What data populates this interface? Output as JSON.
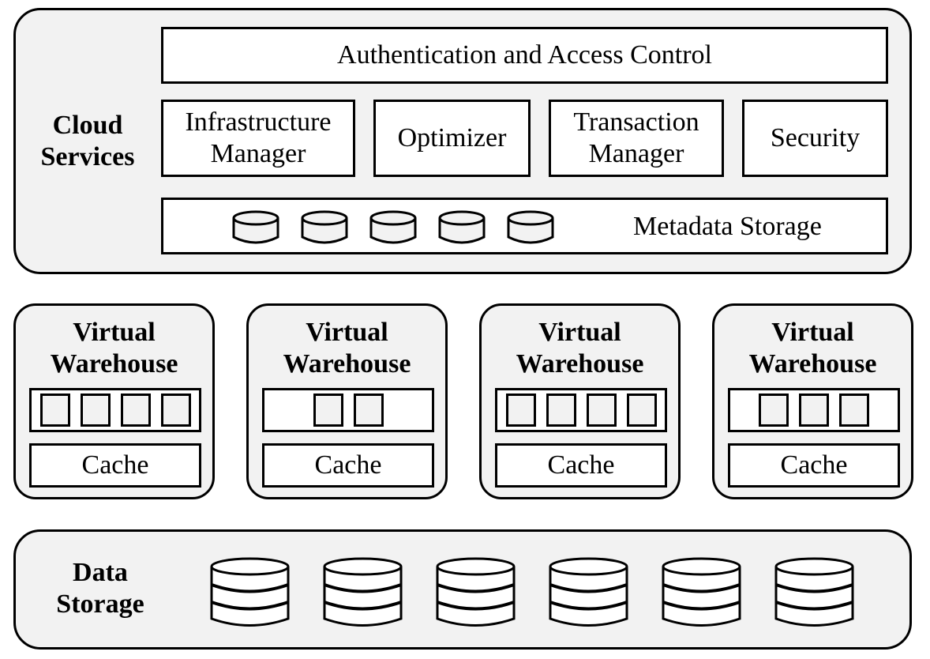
{
  "cloud_services": {
    "title": "Cloud Services",
    "title_line1": "Cloud",
    "title_line2": "Services",
    "auth": "Authentication and Access Control",
    "components": [
      {
        "line1": "Infrastructure",
        "line2": "Manager"
      },
      {
        "line1": "Optimizer",
        "line2": ""
      },
      {
        "line1": "Transaction",
        "line2": "Manager"
      },
      {
        "line1": "Security",
        "line2": ""
      }
    ],
    "metadata": {
      "label": "Metadata Storage",
      "cylinder_count": 5
    }
  },
  "warehouses": [
    {
      "title_line1": "Virtual",
      "title_line2": "Warehouse",
      "node_count": 4,
      "cache_label": "Cache"
    },
    {
      "title_line1": "Virtual",
      "title_line2": "Warehouse",
      "node_count": 2,
      "cache_label": "Cache"
    },
    {
      "title_line1": "Virtual",
      "title_line2": "Warehouse",
      "node_count": 4,
      "cache_label": "Cache"
    },
    {
      "title_line1": "Virtual",
      "title_line2": "Warehouse",
      "node_count": 3,
      "cache_label": "Cache"
    }
  ],
  "data_storage": {
    "title_line1": "Data",
    "title_line2": "Storage",
    "cylinder_count": 6
  },
  "colors": {
    "panel_fill": "#f2f2f2",
    "box_fill": "#ffffff",
    "stroke": "#000000"
  }
}
